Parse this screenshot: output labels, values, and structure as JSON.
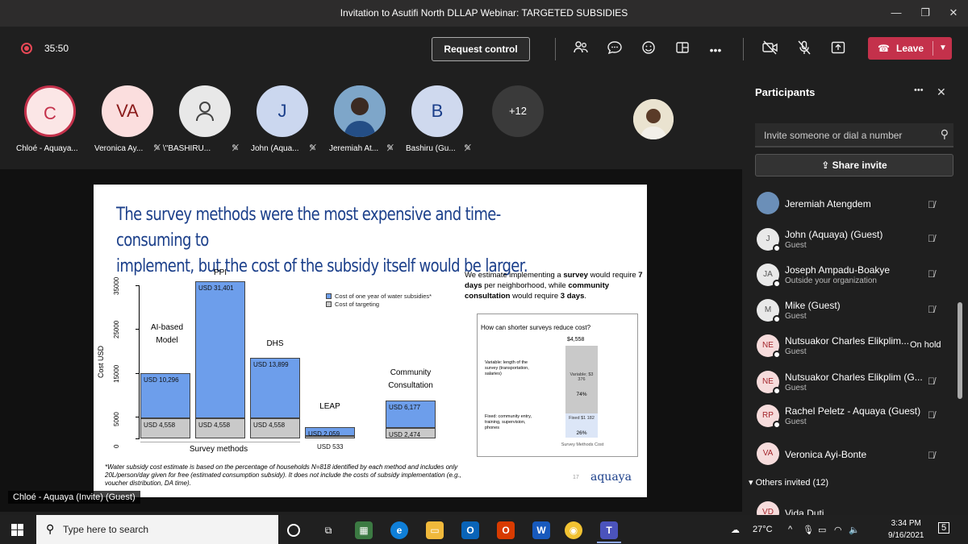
{
  "window": {
    "title": "Invitation to Asutifi North DLLAP Webinar: TARGETED SUBSIDIES"
  },
  "toolbar": {
    "timer": "35:50",
    "request_control": "Request control",
    "leave": "Leave"
  },
  "strip": {
    "participants": [
      {
        "initials": "C",
        "name": "Chloé - Aquaya..."
      },
      {
        "initials": "VA",
        "name": "Veronica Ay..."
      },
      {
        "initials": "",
        "name": "\\\"BASHIRU..."
      },
      {
        "initials": "J",
        "name": "John (Aqua..."
      },
      {
        "initials": "",
        "name": "Jeremiah At..."
      },
      {
        "initials": "B",
        "name": "Bashiru (Gu..."
      }
    ],
    "more": "+12"
  },
  "slide": {
    "title_line1": "The survey methods were the most expensive and time-consuming to",
    "title_line2": "implement, but the cost of the subsidy itself would be larger.",
    "legend_subsidy": "Cost of one year of water subsidies*",
    "legend_targeting": "Cost of targeting",
    "estimate_text_1": "We estimate implementing a ",
    "estimate_bold_1": "survey",
    "estimate_text_2": " would require ",
    "estimate_bold_2": "7 days",
    "estimate_text_3": " per neighborhood, while ",
    "estimate_bold_3": "community consultation",
    "estimate_text_4": " would require ",
    "estimate_bold_4": "3 days",
    "estimate_text_5": ".",
    "inset_title": "How can shorter surveys reduce cost?",
    "inset_total": "$4,558",
    "inset_variable_desc": "Variable: length of the survey (transportation, salaries)",
    "inset_variable_bar": "Variable; $3 376",
    "inset_variable_pct": "74%",
    "inset_fixed_desc": "Fixed: community entry, training, supervision, phones",
    "inset_fixed_bar": "Fixed $1 182",
    "inset_fixed_pct": "26%",
    "inset_axis": "Survey Methods Cost",
    "footnote": "*Water subsidy cost estimate is based on the percentage of households N=818 identified by each method and includes only 20L/person/day given for free (estimated consumption subsidy). It does not include the costs of subsidy implementation (e.g., voucher distribution, DA time).",
    "page_num": "17",
    "logo": "aquaya",
    "survey_methods_label": "Survey methods"
  },
  "chart_data": {
    "type": "bar",
    "stacked": true,
    "ylabel": "Cost USD",
    "ylim": [
      0,
      35000
    ],
    "yticks": [
      "0",
      "5000",
      "15000",
      "25000",
      "35000"
    ],
    "categories": [
      "AI-based Model",
      "PPI",
      "DHS",
      "LEAP",
      "Community Consultation"
    ],
    "series": [
      {
        "name": "Cost of targeting",
        "values": [
          4558,
          4558,
          4558,
          533,
          2474
        ],
        "labels": [
          "USD 4,558",
          "USD 4,558",
          "USD 4,558",
          "USD 533",
          "USD 2,474"
        ]
      },
      {
        "name": "Cost of one year of water subsidies*",
        "values": [
          10296,
          31401,
          13899,
          2059,
          6177
        ],
        "labels": [
          "USD 10,296",
          "USD 31,401",
          "USD 13,899",
          "USD 2,059",
          "USD 6,177"
        ]
      }
    ],
    "category_labels": [
      [
        "AI-based",
        "Model"
      ],
      [
        "PPI"
      ],
      [
        "DHS"
      ],
      [
        "LEAP"
      ],
      [
        "Community",
        "Consultation"
      ]
    ],
    "colors": {
      "targeting": "#c9c9c9",
      "subsidy": "#6d9eeb"
    }
  },
  "presenter": {
    "label": "Chloé - Aquaya (Invite) (Guest)"
  },
  "panel": {
    "title": "Participants",
    "invite_placeholder": "Invite someone or dial a number",
    "share_invite": "Share invite",
    "on_hold": "On hold",
    "others": "Others invited (12)",
    "people": [
      {
        "initials": "",
        "name": "Jeremiah Atengdem",
        "sub": ""
      },
      {
        "initials": "J",
        "name": "John (Aquaya) (Guest)",
        "sub": "Guest"
      },
      {
        "initials": "JA",
        "name": "Joseph Ampadu-Boakye",
        "sub": "Outside your organization"
      },
      {
        "initials": "M",
        "name": "Mike (Guest)",
        "sub": "Guest"
      },
      {
        "initials": "NE",
        "name": "Nutsuakor Charles Elikplim...",
        "sub": "Guest"
      },
      {
        "initials": "NE",
        "name": "Nutsuakor Charles Elikplim (G...",
        "sub": "Guest"
      },
      {
        "initials": "RP",
        "name": "Rachel Peletz - Aquaya (Guest)",
        "sub": "Guest"
      },
      {
        "initials": "VA",
        "name": "Veronica Ayi-Bonte",
        "sub": ""
      },
      {
        "initials": "VD",
        "name": "Vida Duti",
        "sub": ""
      }
    ]
  },
  "taskbar": {
    "search_placeholder": "Type here to search",
    "temperature": "27°C",
    "time": "3:34 PM",
    "date": "9/16/2021",
    "notifications": "5"
  }
}
